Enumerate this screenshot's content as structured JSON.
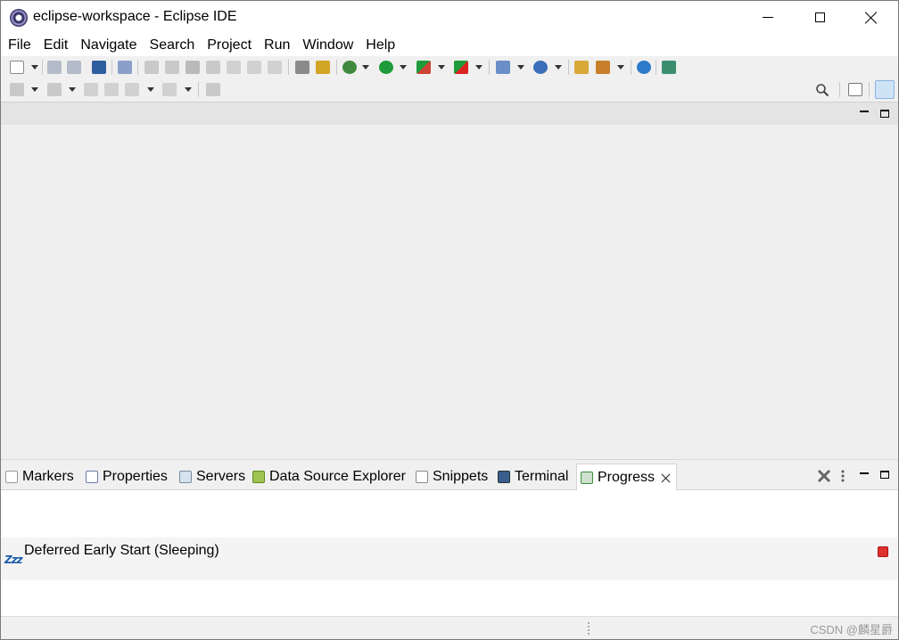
{
  "window": {
    "title": "eclipse-workspace - Eclipse IDE"
  },
  "menu": [
    "File",
    "Edit",
    "Navigate",
    "Search",
    "Project",
    "Run",
    "Window",
    "Help"
  ],
  "toolbar": {
    "row1_icons": [
      "new-wizard-icon",
      "save-icon",
      "save-all-icon",
      "open-console-icon",
      "skip-breakpoints-icon",
      "resume-icon",
      "suspend-icon",
      "terminate-icon",
      "disconnect-icon",
      "step-into-icon",
      "step-over-icon",
      "step-return-icon",
      "use-step-filters-icon",
      "toggle-breakpoint-icon",
      "debug-icon",
      "run-icon",
      "coverage-icon",
      "external-tools-icon",
      "new-java-project-icon",
      "new-class-icon",
      "open-type-icon",
      "open-task-icon",
      "browser-icon",
      "ant-icon"
    ],
    "row2_icons": [
      "next-annotation-icon",
      "previous-annotation-icon",
      "last-edit-icon",
      "back-icon",
      "forward-icon",
      "pin-editor-icon"
    ],
    "search_icon": "search-icon",
    "open_perspective_icon": "open-perspective-icon",
    "java_ee_perspective_icon": "java-ee-perspective-icon"
  },
  "panel": {
    "tabs": [
      {
        "label": "Markers",
        "icon": "markers-icon"
      },
      {
        "label": "Properties",
        "icon": "properties-icon"
      },
      {
        "label": "Servers",
        "icon": "servers-icon"
      },
      {
        "label": "Data Source Explorer",
        "icon": "data-source-icon"
      },
      {
        "label": "Snippets",
        "icon": "snippets-icon"
      },
      {
        "label": "Terminal",
        "icon": "terminal-icon"
      },
      {
        "label": "Progress",
        "icon": "progress-icon"
      }
    ],
    "active_tab": "Progress",
    "jobs": [
      {
        "label": "Deferred Early Start (Sleeping)",
        "icon_text": "Zzz"
      }
    ]
  },
  "watermark": "CSDN @麟星爵",
  "colors": {
    "run_green": "#1e9b3a",
    "stop_red": "#e03131",
    "zzz_blue": "#1c5aa8"
  }
}
